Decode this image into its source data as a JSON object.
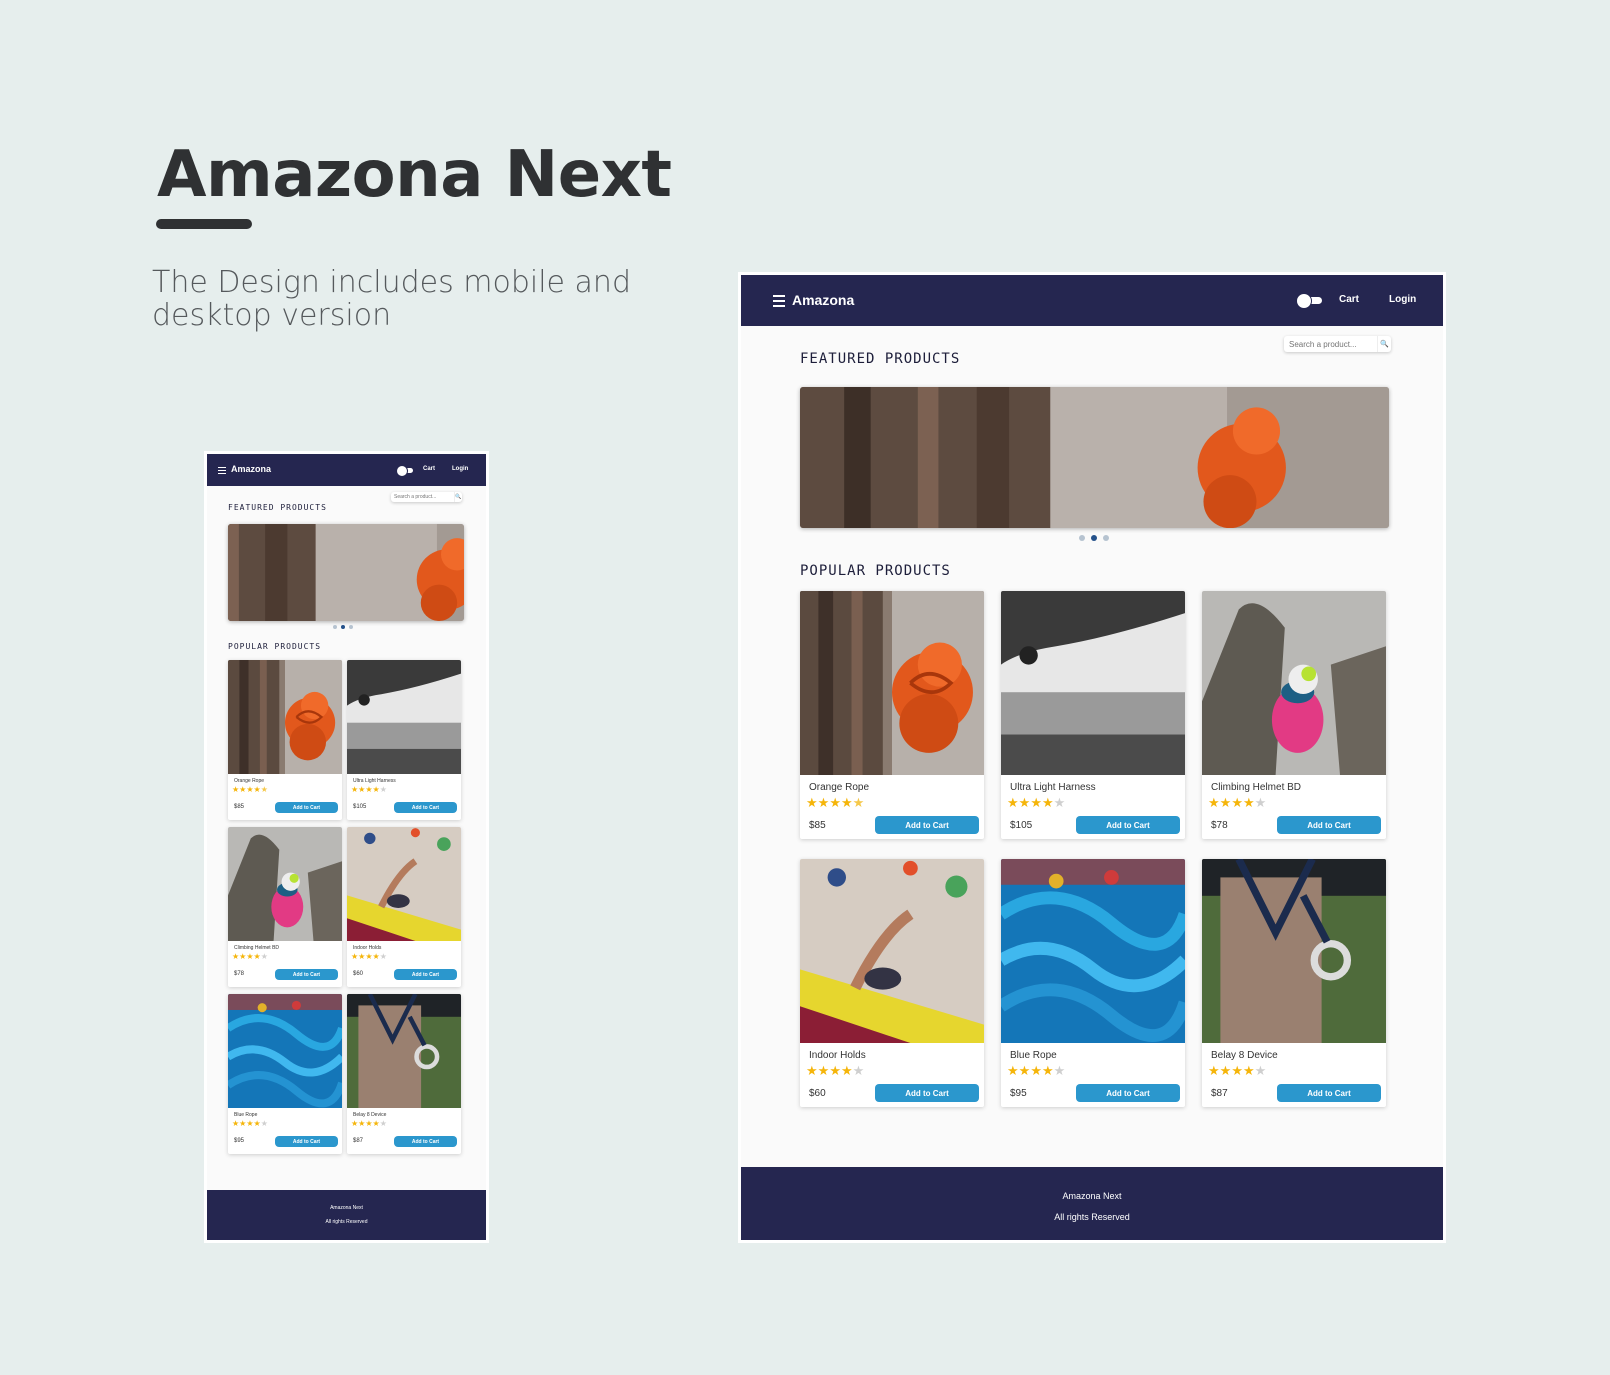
{
  "presentation": {
    "title": "Amazona Next",
    "subtitle": "The Design includes mobile and desktop version"
  },
  "app": {
    "brand": "Amazona",
    "nav_cart": "Cart",
    "nav_login": "Login",
    "search_placeholder": "Search a product...",
    "featured_title": "FEATURED PRODUCTS",
    "popular_title": "POPULAR PRODUCTS",
    "carousel": {
      "slides": 3,
      "active": 2
    },
    "add_to_cart_label": "Add to Cart",
    "footer_line1": "Amazona Next",
    "footer_line2": "All rights Reserved",
    "accent_color": "#2b97cd",
    "nav_color": "#252650",
    "products": [
      {
        "name": "Orange Rope",
        "price": "$85",
        "rating": 4.5
      },
      {
        "name": "Ultra Light Harness",
        "price": "$105",
        "rating": 4
      },
      {
        "name": "Climbing Helmet BD",
        "price": "$78",
        "rating": 4
      },
      {
        "name": "Indoor Holds",
        "price": "$60",
        "rating": 4
      },
      {
        "name": "Blue Rope",
        "price": "$95",
        "rating": 4
      },
      {
        "name": "Belay 8 Device",
        "price": "$87",
        "rating": 4
      }
    ]
  }
}
